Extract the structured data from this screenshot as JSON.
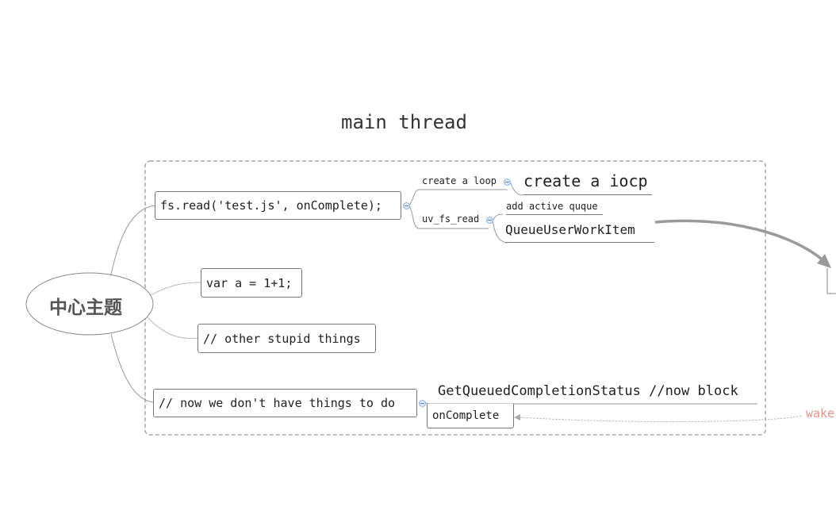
{
  "diagram": {
    "title": "main thread",
    "center_topic": "中心主题",
    "branch_fs_read": "fs.read('test.js', onComplete);",
    "branch_var": "var a = 1+1;",
    "branch_other": "// other stupid things",
    "branch_now": "// now we don't have things to do",
    "create_loop_label": "create a loop",
    "create_iocp": "create a iocp",
    "uv_fs_read_label": "uv_fs_read",
    "add_active_label": "add active quque",
    "queue_user_work_item": "QueueUserWorkItem",
    "get_queued": "GetQueuedCompletionStatus //now block",
    "on_complete": "onComplete",
    "wake_partial": "wake"
  },
  "colors": {
    "frame_border": "#a0a0a0",
    "connector": "#888888",
    "arrow": "#999999",
    "wake_text": "#e6928a",
    "collapse_dot": "#8fb1e2"
  }
}
